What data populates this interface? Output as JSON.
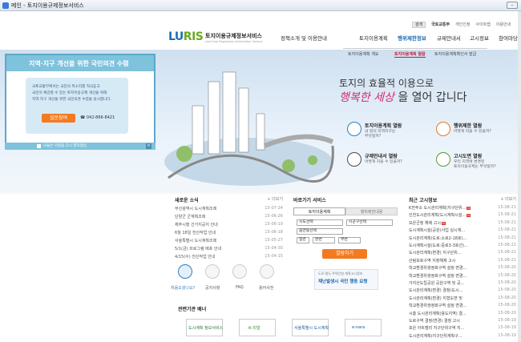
{
  "window": {
    "title": "메인 - 토지이용규제정보서비스",
    "min_label": "–"
  },
  "util": {
    "search": "검색",
    "items": [
      "국토교통부",
      "개인인정",
      "사이트맵",
      "이용안내"
    ]
  },
  "logo": {
    "brand_a": "LU",
    "brand_b": "RIS",
    "name": "토지이용규제정보서비스",
    "sub": "Land Use Regulation Information Service"
  },
  "gnb": [
    "정책소개 및 이용안내",
    "토지이용계획",
    "행위제한정보",
    "규제안내서",
    "고시정보",
    "참여마당"
  ],
  "subnav": [
    "토지이용계획 개요",
    "토지이용계획 열람",
    "토지이용계획확인서 발급"
  ],
  "leftbox": {
    "title": "지역·지구 개선을 위한 국민의견 수렴",
    "lines": [
      "국토교통부에서는 국민의 목소리를 적극듣고",
      "국민이 체감할 수 있는 토지이용규제 개선을 위해",
      "지역·지구 개선을 위한 국민의견 수렴을 실시합니다."
    ],
    "button": "설문참여",
    "tel": "042-866-8421",
    "footer": "오늘은 이창을 다시 열지않음"
  },
  "slogan": {
    "line1": "토지의 효율적 이용으로",
    "hl": "행복한 세상",
    "rest": "을 열어 갑니다"
  },
  "quick": [
    {
      "title": "토지이용계획 열람",
      "desc1": "내 땅의 지역지구는",
      "desc2": "무엇일까?",
      "color": "#2f7ec0"
    },
    {
      "title": "행위제한 열람",
      "desc1": "어떻게 지을 수 있을까?",
      "desc2": "",
      "color": "#e07b1e"
    },
    {
      "title": "규제안내서 열람",
      "desc1": "어떻게 지을 수 있을까?",
      "desc2": "",
      "color": "#4a4a4a"
    },
    {
      "title": "고시도면 열람",
      "desc1": "우리 지역에 변경된",
      "desc2": "토지이용규제는 무엇일까?",
      "color": "#5a9a2a"
    }
  ],
  "news": {
    "title": "새로운 소식",
    "more": "+ 더보기",
    "rows": [
      {
        "t": "부산광역시 도시계획조례",
        "d": "15-07-24"
      },
      {
        "t": "단양군 군계획조례",
        "d": "15-06-26"
      },
      {
        "t": "제주시행 건가지공지 안내",
        "d": "15-06-19"
      },
      {
        "t": "6월 18일 전산작업 안내",
        "d": "15-06-18"
      },
      {
        "t": "서울특별시 도시계획조례",
        "d": "15-05-27"
      },
      {
        "t": "5/1(금) 프로그램 배포 안내",
        "d": "15-04-30"
      },
      {
        "t": "4/15(수) 전산작업 안내",
        "d": "15-04-15"
      }
    ]
  },
  "icons": [
    {
      "label": "처음오셨나요?",
      "color": "#2f7ec0"
    },
    {
      "label": "공지사항",
      "color": "#666"
    },
    {
      "label": "FAQ",
      "color": "#666"
    },
    {
      "label": "용어사전",
      "color": "#666"
    }
  ],
  "banner": {
    "title": "관련기관 배너",
    "items": [
      "도시계획 정보서비스",
      "씨:리얼",
      "서울특별시 도시계획",
      "e-nara"
    ]
  },
  "service": {
    "title": "바로가기 서비스",
    "more": "+ 더보기",
    "tabs": [
      "토지이용계획",
      "행위제한내용"
    ],
    "sido": "시도선택",
    "sigungu": "시군구선택",
    "eup": "읍면동선택",
    "jibun": "일반",
    "bon": "본번",
    "bu": "부번",
    "button": "열람하기",
    "ad1": "도로·철도·주택건설 계획고시정보",
    "ad2": "재난발생시 국민 행동 요령"
  },
  "notice": {
    "title": "최근 고시정보",
    "more": "+ 더보기",
    "rows": [
      {
        "t": "K전주소 도시관리계획(지구단위...",
        "d": "15-08-21",
        "n": true
      },
      {
        "t": "인천도시관리계획(도시계획시설...",
        "d": "15-08-21",
        "n": true
      },
      {
        "t": "보은군청 해제 고시",
        "d": "15-08-21",
        "n": true
      },
      {
        "t": "도시계획시설(공원)사업 실시계...",
        "d": "15-08-21",
        "n": false
      },
      {
        "t": "도시관리계획(도로:소로2-18호)...",
        "d": "15-08-21",
        "n": false
      },
      {
        "t": "도시계획시설(도로:중로3-3호선)...",
        "d": "15-08-21",
        "n": false
      },
      {
        "t": "도시관리계획(변경) 지구단위...",
        "d": "15-08-21",
        "n": false
      },
      {
        "t": "산림보호구역 지정해제 고시",
        "d": "15-08-21",
        "n": false
      },
      {
        "t": "학교환경위생정화구역 설정 변경...",
        "d": "15-08-20",
        "n": false
      },
      {
        "t": "학교환경위생정화구역 설정 변경...",
        "d": "15-08-20",
        "n": false
      },
      {
        "t": "가지산도립공원 공원구역 및 공...",
        "d": "15-08-20",
        "n": false
      },
      {
        "t": "도시관리계획(변경) 결정(도시...",
        "d": "15-08-20",
        "n": false
      },
      {
        "t": "도시관리계획(변경) 지형도면 및",
        "d": "15-08-20",
        "n": false
      },
      {
        "t": "학교환경위생정화구역 설정 변경...",
        "d": "15-08-20",
        "n": false
      },
      {
        "t": "시흥 도시관리계획(용도지역) 결...",
        "d": "15-08-20",
        "n": false
      },
      {
        "t": "도로구역 결정(변경) 결정 고시",
        "d": "15-08-19",
        "n": false
      },
      {
        "t": "포은 아트벨리 지구단위구역 지...",
        "d": "15-08-19",
        "n": false
      },
      {
        "t": "도시관리계획(지구단위계획구...",
        "d": "15-08-19",
        "n": false
      }
    ]
  }
}
